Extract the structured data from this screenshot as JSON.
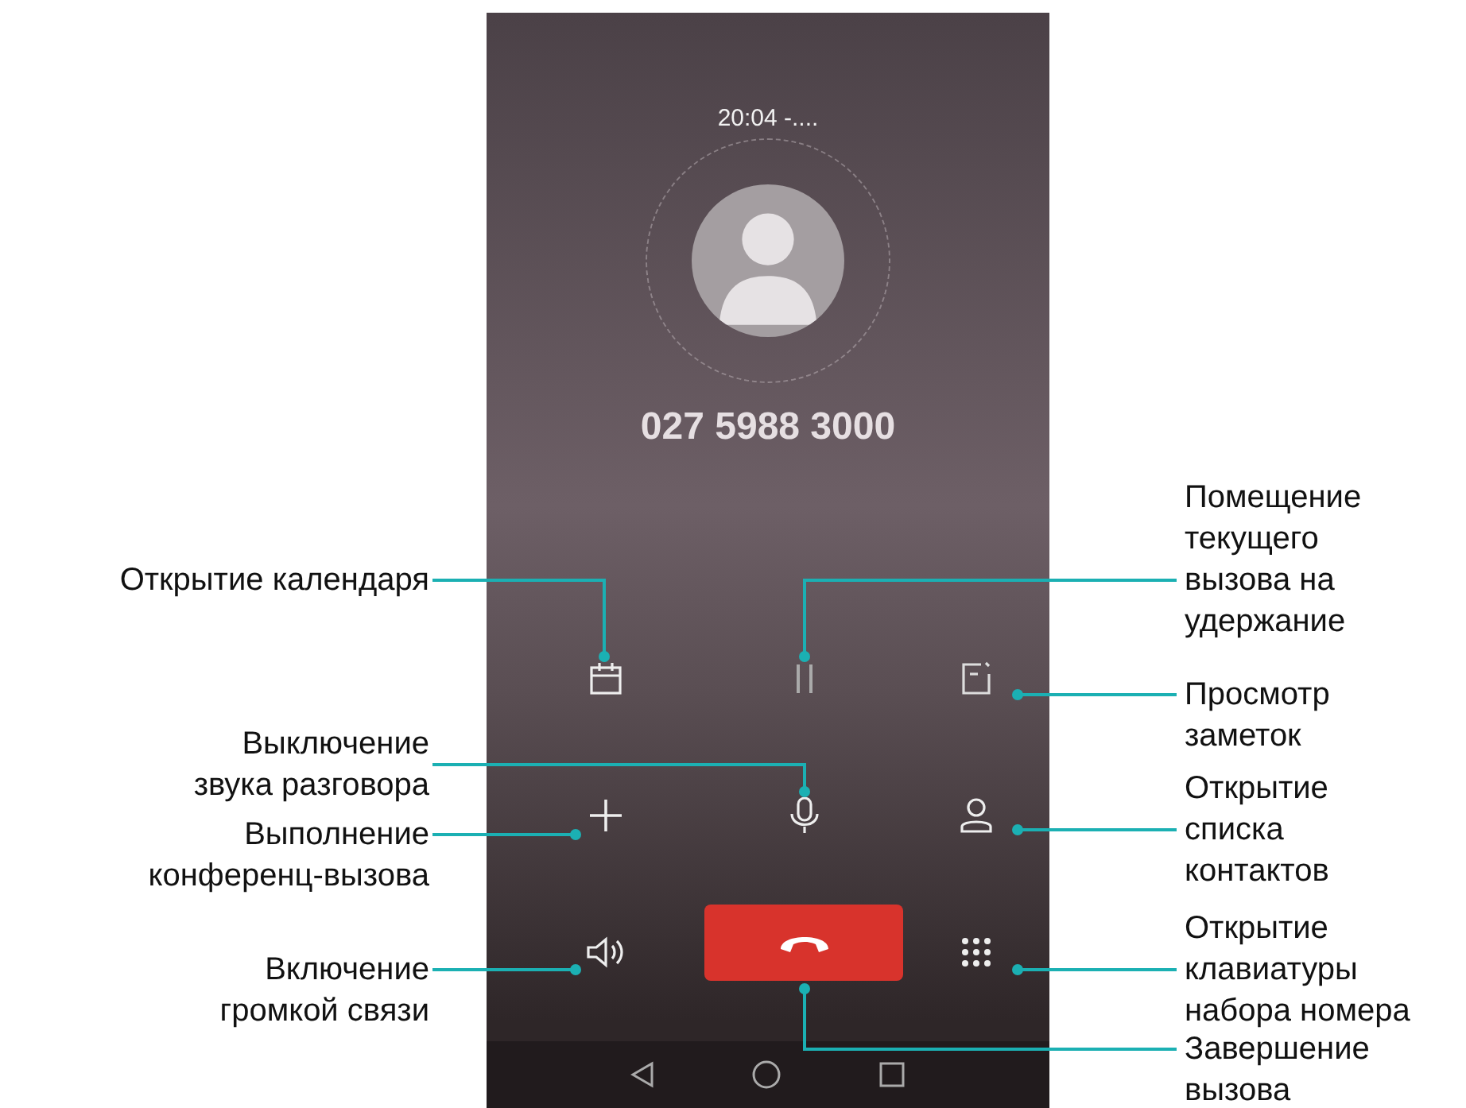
{
  "phone": {
    "call_time": "20:04 -....",
    "number": "027 5988 3000",
    "buttons": [
      {
        "kind": "calendar",
        "callout": "Открытие календаря"
      },
      {
        "kind": "hold",
        "callout": "Помещение\nтекущего\nвызова на\nудержание"
      },
      {
        "kind": "notes",
        "callout": "Просмотр\nзаметок"
      },
      {
        "kind": "mute",
        "callout": "Выключение\nзвука разговора"
      },
      {
        "kind": "add_call",
        "callout": "Выполнение\nконференц-вызова"
      },
      {
        "kind": "contacts",
        "callout": "Открытие\nсписка\nконтактов"
      },
      {
        "kind": "speaker",
        "callout": "Включение\nгромкой связи"
      },
      {
        "kind": "keypad",
        "callout": "Открытие\nклавиатуры\nнабора номера"
      },
      {
        "kind": "end_call",
        "callout": "Завершение\nвызова"
      }
    ],
    "nav": [
      {
        "kind": "back"
      },
      {
        "kind": "home"
      },
      {
        "kind": "recents"
      }
    ]
  }
}
